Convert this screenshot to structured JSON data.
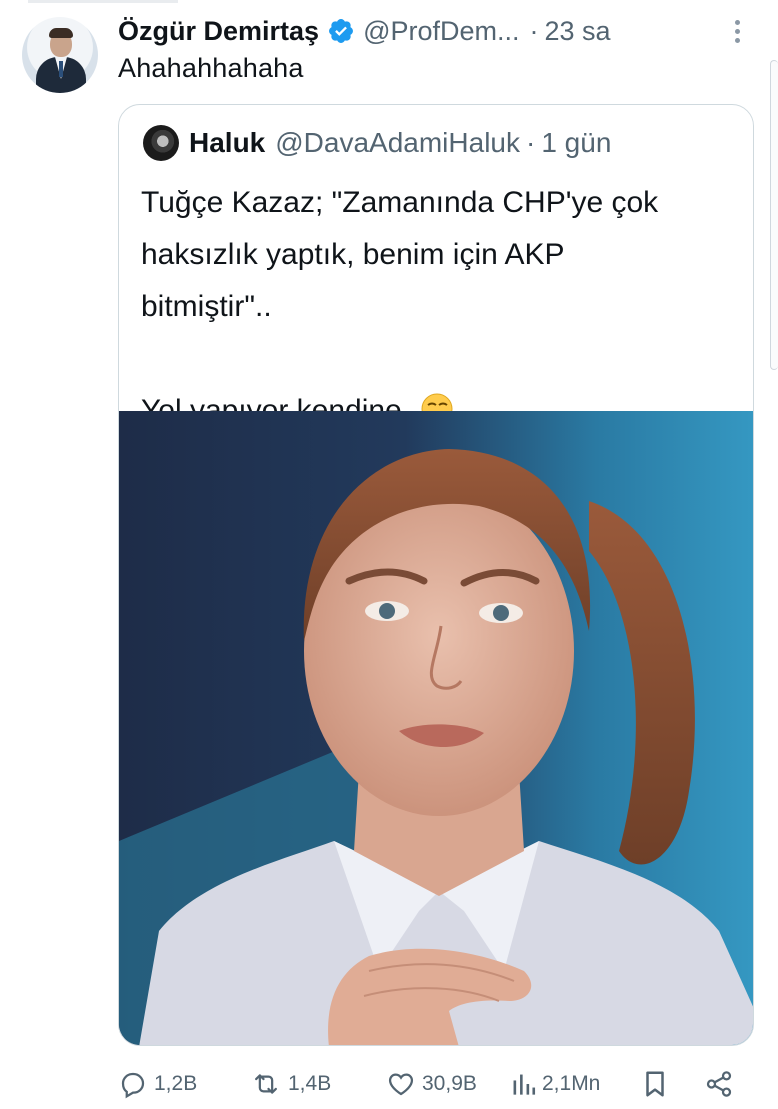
{
  "tweet": {
    "author": {
      "display_name": "Özgür Demirtaş",
      "handle": "@ProfDem...",
      "verified": true,
      "time": "23 sa"
    },
    "dot": "·",
    "text": "Ahahahhahaha",
    "quoted": {
      "author": {
        "display_name": "Haluk",
        "handle": "@DavaAdamiHaluk",
        "time": "1 gün"
      },
      "dot": "·",
      "text_lines": [
        "Tuğçe Kazaz; \"Zamanında CHP'ye çok",
        "haksızlık yaptık, benim için AKP",
        "bitmiştir\".."
      ],
      "text_last": "Yol yapıyor kendine..",
      "emoji": "smirking-face-emoji"
    },
    "actions": {
      "replies": "1,2B",
      "retweets": "1,4B",
      "likes": "30,9B",
      "views": "2,1Mn"
    }
  },
  "colors": {
    "text_primary": "#0f1419",
    "text_secondary": "#536471",
    "verified_blue": "#1d9bf0",
    "border": "#cfd9de"
  }
}
